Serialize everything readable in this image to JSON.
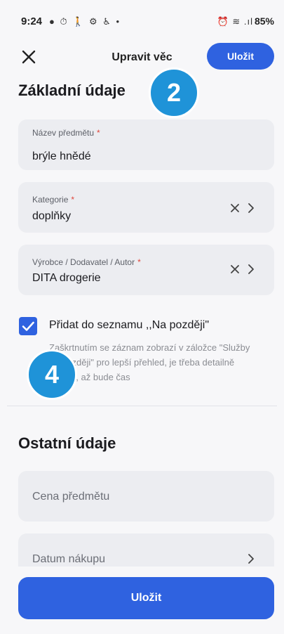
{
  "status_bar": {
    "time": "9:24",
    "left_icons": "● ⏱ 🚶 ⚙ ♿ •",
    "right_icons": "⏰ ≋ .ıl",
    "battery": "85%"
  },
  "header": {
    "title": "Upravit věc",
    "save_label": "Uložit"
  },
  "badges": {
    "step_2": "2",
    "step_4": "4"
  },
  "basic_section": {
    "title": "Základní údaje",
    "fields": [
      {
        "label": "Název předmětu",
        "required": "*",
        "value": "brýle hnědé"
      },
      {
        "label": "Kategorie",
        "required": "*",
        "value": "doplňky"
      },
      {
        "label": "Výrobce / Dodavatel / Autor",
        "required": "*",
        "value": "DITA drogerie"
      }
    ],
    "later_checkbox": {
      "label": "Přidat do seznamu ,,Na později\"",
      "help": "Zaškrtnutím se záznam zobrazí v záložce \"Služby na později\" pro lepší přehled, je třeba detailně doplnit, až bude čas",
      "checked": true
    }
  },
  "other_section": {
    "title": "Ostatní údaje",
    "fields": [
      {
        "placeholder": "Cena předmětu"
      },
      {
        "placeholder": "Datum nákupu"
      }
    ]
  },
  "footer": {
    "save_label": "Uložit"
  },
  "colors": {
    "accent": "#2f62e0",
    "badge": "#1f93d8",
    "field_bg": "#ecedf1",
    "page_bg": "#f7f7f9",
    "required": "#e0463b"
  }
}
